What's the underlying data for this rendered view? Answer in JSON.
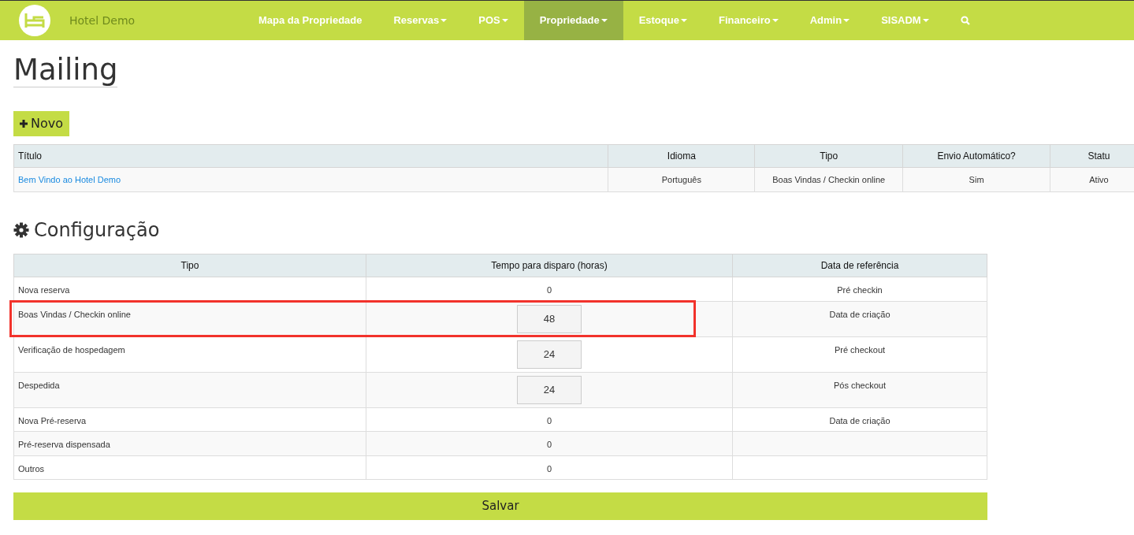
{
  "navbar": {
    "brand": "Hotel Demo",
    "items": [
      {
        "label": "Mapa da Propriedade",
        "dropdown": false,
        "selected": false
      },
      {
        "label": "Reservas",
        "dropdown": true,
        "selected": false
      },
      {
        "label": "POS",
        "dropdown": true,
        "selected": false
      },
      {
        "label": "Propriedade",
        "dropdown": true,
        "selected": true
      },
      {
        "label": "Estoque",
        "dropdown": true,
        "selected": false
      },
      {
        "label": "Financeiro",
        "dropdown": true,
        "selected": false
      },
      {
        "label": "Admin",
        "dropdown": true,
        "selected": false
      },
      {
        "label": "SISADM",
        "dropdown": true,
        "selected": false
      }
    ]
  },
  "page_title": "Mailing",
  "new_button": "Novo",
  "mailing_table": {
    "columns": [
      "Título",
      "Idioma",
      "Tipo",
      "Envio Automático?",
      "Statu"
    ],
    "rows": [
      [
        "Bem Vindo ao Hotel Demo",
        "Português",
        "Boas Vindas / Checkin online",
        "Sim",
        "Ativo"
      ]
    ]
  },
  "config": {
    "title": "Configuração",
    "columns": [
      "Tipo",
      "Tempo para disparo (horas)",
      "Data de referência"
    ],
    "rows": [
      {
        "tipo": "Nova reserva",
        "kind": "text",
        "tempo": "0",
        "referencia": "Pré checkin",
        "highlighted": false
      },
      {
        "tipo": "Boas Vindas / Checkin online",
        "kind": "input",
        "tempo": "48",
        "referencia": "Data de criação",
        "highlighted": true
      },
      {
        "tipo": "Verificação de hospedagem",
        "kind": "input",
        "tempo": "24",
        "referencia": "Pré checkout",
        "highlighted": false
      },
      {
        "tipo": "Despedida",
        "kind": "input",
        "tempo": "24",
        "referencia": "Pós checkout",
        "highlighted": false
      },
      {
        "tipo": "Nova Pré-reserva",
        "kind": "text",
        "tempo": "0",
        "referencia": "Data de criação",
        "highlighted": false
      },
      {
        "tipo": "Pré-reserva dispensada",
        "kind": "text",
        "tempo": "0",
        "referencia": "",
        "highlighted": false
      },
      {
        "tipo": "Outros",
        "kind": "text",
        "tempo": "0",
        "referencia": "",
        "highlighted": false
      }
    ]
  },
  "save_button": "Salvar"
}
